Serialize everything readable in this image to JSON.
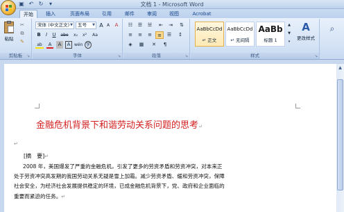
{
  "window": {
    "title": "文档 1 - Microsoft Word"
  },
  "tabs": [
    "开始",
    "插入",
    "页面布局",
    "引用",
    "邮件",
    "审阅",
    "视图",
    "Acrobat"
  ],
  "ribbon": {
    "clipboard": {
      "paste": "粘贴",
      "label": "剪贴板"
    },
    "font": {
      "font_name": "宋体 (中文正文)",
      "font_size": "五号",
      "clear_format": "A",
      "grow": "A",
      "shrink": "A",
      "bold": "B",
      "italic": "I",
      "underline": "U",
      "strike": "abe",
      "subscript": "x₂",
      "superscript": "x²",
      "change_case": "Aa",
      "highlight": "ab",
      "font_color": "A",
      "char_shade": "A",
      "char_border": "A",
      "enclose": "字",
      "phonetic": "wén",
      "label": "字体"
    },
    "paragraph": {
      "label": "段落"
    },
    "styles": {
      "items": [
        {
          "sample": "AaBbCcDd",
          "name": "↵ 正文"
        },
        {
          "sample": "AaBbCcDd",
          "name": "↵ 无间隔"
        },
        {
          "sample": "AaBb",
          "name": "标题 1"
        }
      ],
      "change_styles": "更改样式",
      "label": "样式"
    }
  },
  "document": {
    "title": "金融危机背景下和谐劳动关系问题的思考",
    "abstract_label": "[摘　要]",
    "lines": [
      "2008 年，美国爆发了严重的金融危机，引发了更多的劳资矛盾和劳资冲突，对本来正",
      "处于劳资冲突高发期的我国劳动关系无疑是雪上加霜。减少劳资矛盾、缓和劳资冲突，保障",
      "社会安全，为经济社会发展提供稳定的环境，已成金融危机背景下，党、政府和企业面临的",
      "重要而紧迫的任务。"
    ]
  },
  "colors": {
    "title_red": "#d42020",
    "ribbon_blue": "#c9dbf2"
  }
}
